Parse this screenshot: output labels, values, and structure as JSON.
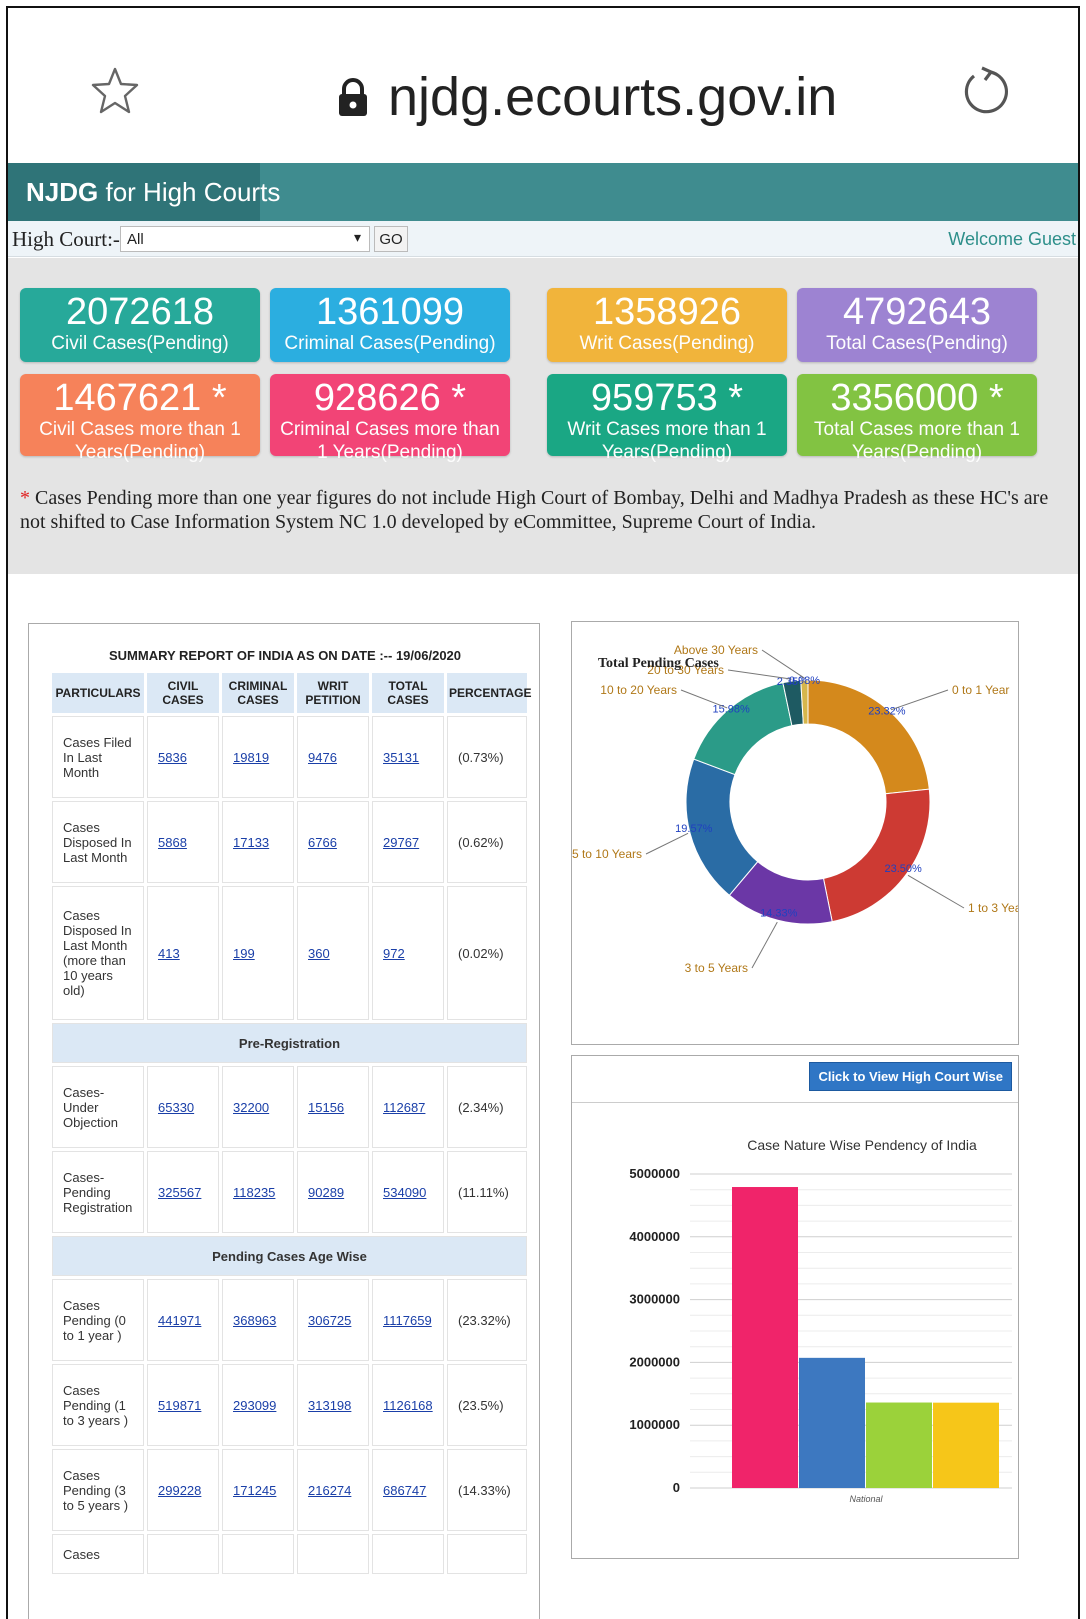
{
  "browser": {
    "url": "njdg.ecourts.gov.in",
    "icons": [
      "star-icon",
      "lock-icon",
      "reload-icon"
    ]
  },
  "header": {
    "brand_bold": "NJDG",
    "brand_rest": " for High Courts"
  },
  "filter": {
    "label": "High Court:-",
    "selected": "All",
    "go_label": "GO",
    "welcome": "Welcome Guest"
  },
  "cards": [
    {
      "num": "2072618",
      "label": "Civil Cases(Pending)",
      "color": "#27a99a"
    },
    {
      "num": "1361099",
      "label": "Criminal Cases(Pending)",
      "color": "#2baee0"
    },
    {
      "num": "1358926",
      "label": "Writ Cases(Pending)",
      "color": "#f1b43b"
    },
    {
      "num": "4792643",
      "label": "Total Cases(Pending)",
      "color": "#9d83d2"
    },
    {
      "num": "1467621 *",
      "label": "Civil Cases more than 1 Years(Pending)",
      "color": "#f6825a"
    },
    {
      "num": "928626 *",
      "label": "Criminal Cases more than 1 Years(Pending)",
      "color": "#f24476"
    },
    {
      "num": "959753 *",
      "label": "Writ Cases more than 1 Years(Pending)",
      "color": "#1aa784"
    },
    {
      "num": "3356000 *",
      "label": "Total Cases more than 1 Years(Pending)",
      "color": "#82c342"
    }
  ],
  "note": {
    "asterisk": "*",
    "text": " Cases Pending more than one year figures do not include High Court of Bombay, Delhi and Madhya Pradesh as these HC's are not shifted to Case Information System NC 1.0 developed by eCommittee, Supreme Court of India."
  },
  "summary": {
    "title": "SUMMARY REPORT OF INDIA AS ON DATE :-- 19/06/2020",
    "columns": [
      "PARTICULARS",
      "CIVIL CASES",
      "CRIMINAL CASES",
      "WRIT PETITION",
      "TOTAL CASES",
      "PERCENTAGE"
    ],
    "rows_a": [
      {
        "label": "Cases Filed In Last Month",
        "civil": "5836",
        "criminal": "19819",
        "writ": "9476",
        "total": "35131",
        "pct": "(0.73%)"
      },
      {
        "label": "Cases Disposed In Last Month",
        "civil": "5868",
        "criminal": "17133",
        "writ": "6766",
        "total": "29767",
        "pct": "(0.62%)"
      },
      {
        "label": "Cases Disposed In Last Month (more than 10 years old)",
        "civil": "413",
        "criminal": "199",
        "writ": "360",
        "total": "972",
        "pct": "(0.02%)"
      }
    ],
    "section_b": "Pre-Registration",
    "rows_b": [
      {
        "label": "Cases-Under Objection",
        "civil": "65330",
        "criminal": "32200",
        "writ": "15156",
        "total": "112687",
        "pct": "(2.34%)"
      },
      {
        "label": "Cases-Pending Registration",
        "civil": "325567",
        "criminal": "118235",
        "writ": "90289",
        "total": "534090",
        "pct": "(11.11%)"
      }
    ],
    "section_c": "Pending Cases Age Wise",
    "rows_c": [
      {
        "label": "Cases Pending (0 to 1 year )",
        "civil": "441971",
        "criminal": "368963",
        "writ": "306725",
        "total": "1117659",
        "pct": "(23.32%)"
      },
      {
        "label": "Cases Pending (1 to 3 years )",
        "civil": "519871",
        "criminal": "293099",
        "writ": "313198",
        "total": "1126168",
        "pct": "(23.5%)"
      },
      {
        "label": "Cases Pending (3 to 5 years )",
        "civil": "299228",
        "criminal": "171245",
        "writ": "216274",
        "total": "686747",
        "pct": "(14.33%)"
      },
      {
        "label": "Cases",
        "civil": "",
        "criminal": "",
        "writ": "",
        "total": "",
        "pct": ""
      }
    ]
  },
  "chart_data": [
    {
      "type": "pie",
      "title": "Total Pending Cases",
      "slices": [
        {
          "name": "0 to 1 Year",
          "value": 23.32,
          "label": "23.32%",
          "color": "#d4891c"
        },
        {
          "name": "1 to 3 Years",
          "value": 23.5,
          "label": "23.50%",
          "color": "#cd3a33"
        },
        {
          "name": "3 to 5 Years",
          "value": 14.33,
          "label": "14.33%",
          "color": "#6b37a6"
        },
        {
          "name": "5 to 10 Years",
          "value": 19.57,
          "label": "19.57%",
          "color": "#2a6ca5"
        },
        {
          "name": "10 to 20 Years",
          "value": 15.98,
          "label": "15.98%",
          "color": "#2b9b88"
        },
        {
          "name": "20 to 30 Years",
          "value": 2.35,
          "label": "2.35%",
          "color": "#1e5a62"
        },
        {
          "name": "Above 30 Years",
          "value": 0.95,
          "label": "0.98%",
          "color": "#d6b64c"
        }
      ]
    },
    {
      "type": "bar",
      "title": "Case Nature Wise Pendency of India",
      "button_label": "Click to View High Court Wise",
      "categories": [
        "National"
      ],
      "series": [
        {
          "values": [
            4792643
          ],
          "color": "#f0246a"
        },
        {
          "values": [
            2072618
          ],
          "color": "#3d78c0"
        },
        {
          "values": [
            1361099
          ],
          "color": "#9bd23a"
        },
        {
          "values": [
            1358926
          ],
          "color": "#f6c619"
        }
      ],
      "yticks": [
        "5000000",
        "4000000",
        "3000000",
        "2000000",
        "1000000",
        "0"
      ],
      "ylim": [
        0,
        5000000
      ]
    }
  ]
}
